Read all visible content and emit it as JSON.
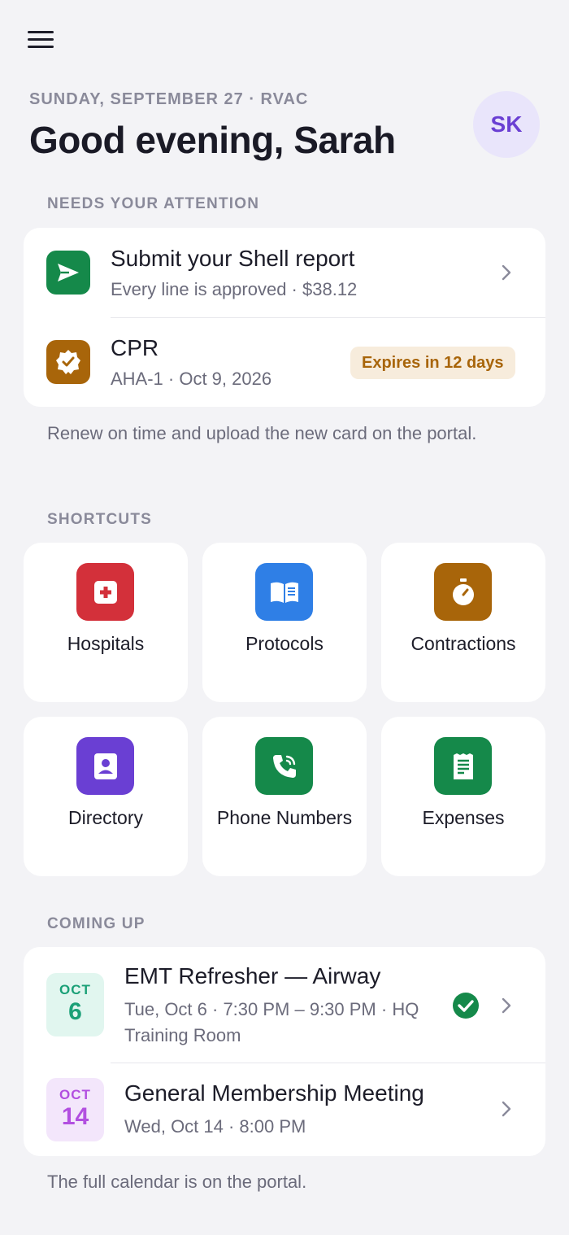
{
  "header": {
    "menu_icon": "hamburger-menu-icon",
    "date_line": "SUNDAY, SEPTEMBER 27 · RVAC",
    "greeting": "Good evening, Sarah",
    "avatar_initials": "SK"
  },
  "attention": {
    "label": "NEEDS YOUR ATTENTION",
    "items": [
      {
        "title": "Submit your Shell report",
        "subtitle": "Every line is approved · $38.12",
        "icon": "send-icon",
        "color": "#15894a"
      },
      {
        "title": "CPR",
        "subtitle": "AHA-1 · Oct 9, 2026",
        "badge": "Expires in 12 days",
        "icon": "certificate-badge-icon",
        "color": "#a8650a"
      }
    ],
    "note": "Renew on time and upload the new card on the portal."
  },
  "shortcuts": {
    "label": "SHORTCUTS",
    "items": [
      {
        "label": "Hospitals",
        "icon": "hospital-cross-icon",
        "color": "#d3303a"
      },
      {
        "label": "Protocols",
        "icon": "open-book-icon",
        "color": "#2f7fe6"
      },
      {
        "label": "Contractions",
        "icon": "stopwatch-icon",
        "color": "#a8650a"
      },
      {
        "label": "Directory",
        "icon": "contact-card-icon",
        "color": "#6a3fd3"
      },
      {
        "label": "Phone Numbers",
        "icon": "phone-icon",
        "color": "#15894a"
      },
      {
        "label": "Expenses",
        "icon": "receipt-icon",
        "color": "#15894a"
      }
    ]
  },
  "coming_up": {
    "label": "COMING UP",
    "events": [
      {
        "month": "OCT",
        "day": "6",
        "title": "EMT Refresher — Airway",
        "subtitle": "Tue, Oct 6 · 7:30 PM – 9:30 PM · HQ Training Room",
        "status_icon": "check-circle-icon"
      },
      {
        "month": "OCT",
        "day": "14",
        "title": "General Membership Meeting",
        "subtitle": "Wed, Oct 14 · 8:00 PM"
      }
    ],
    "note": "The full calendar is on the portal."
  }
}
